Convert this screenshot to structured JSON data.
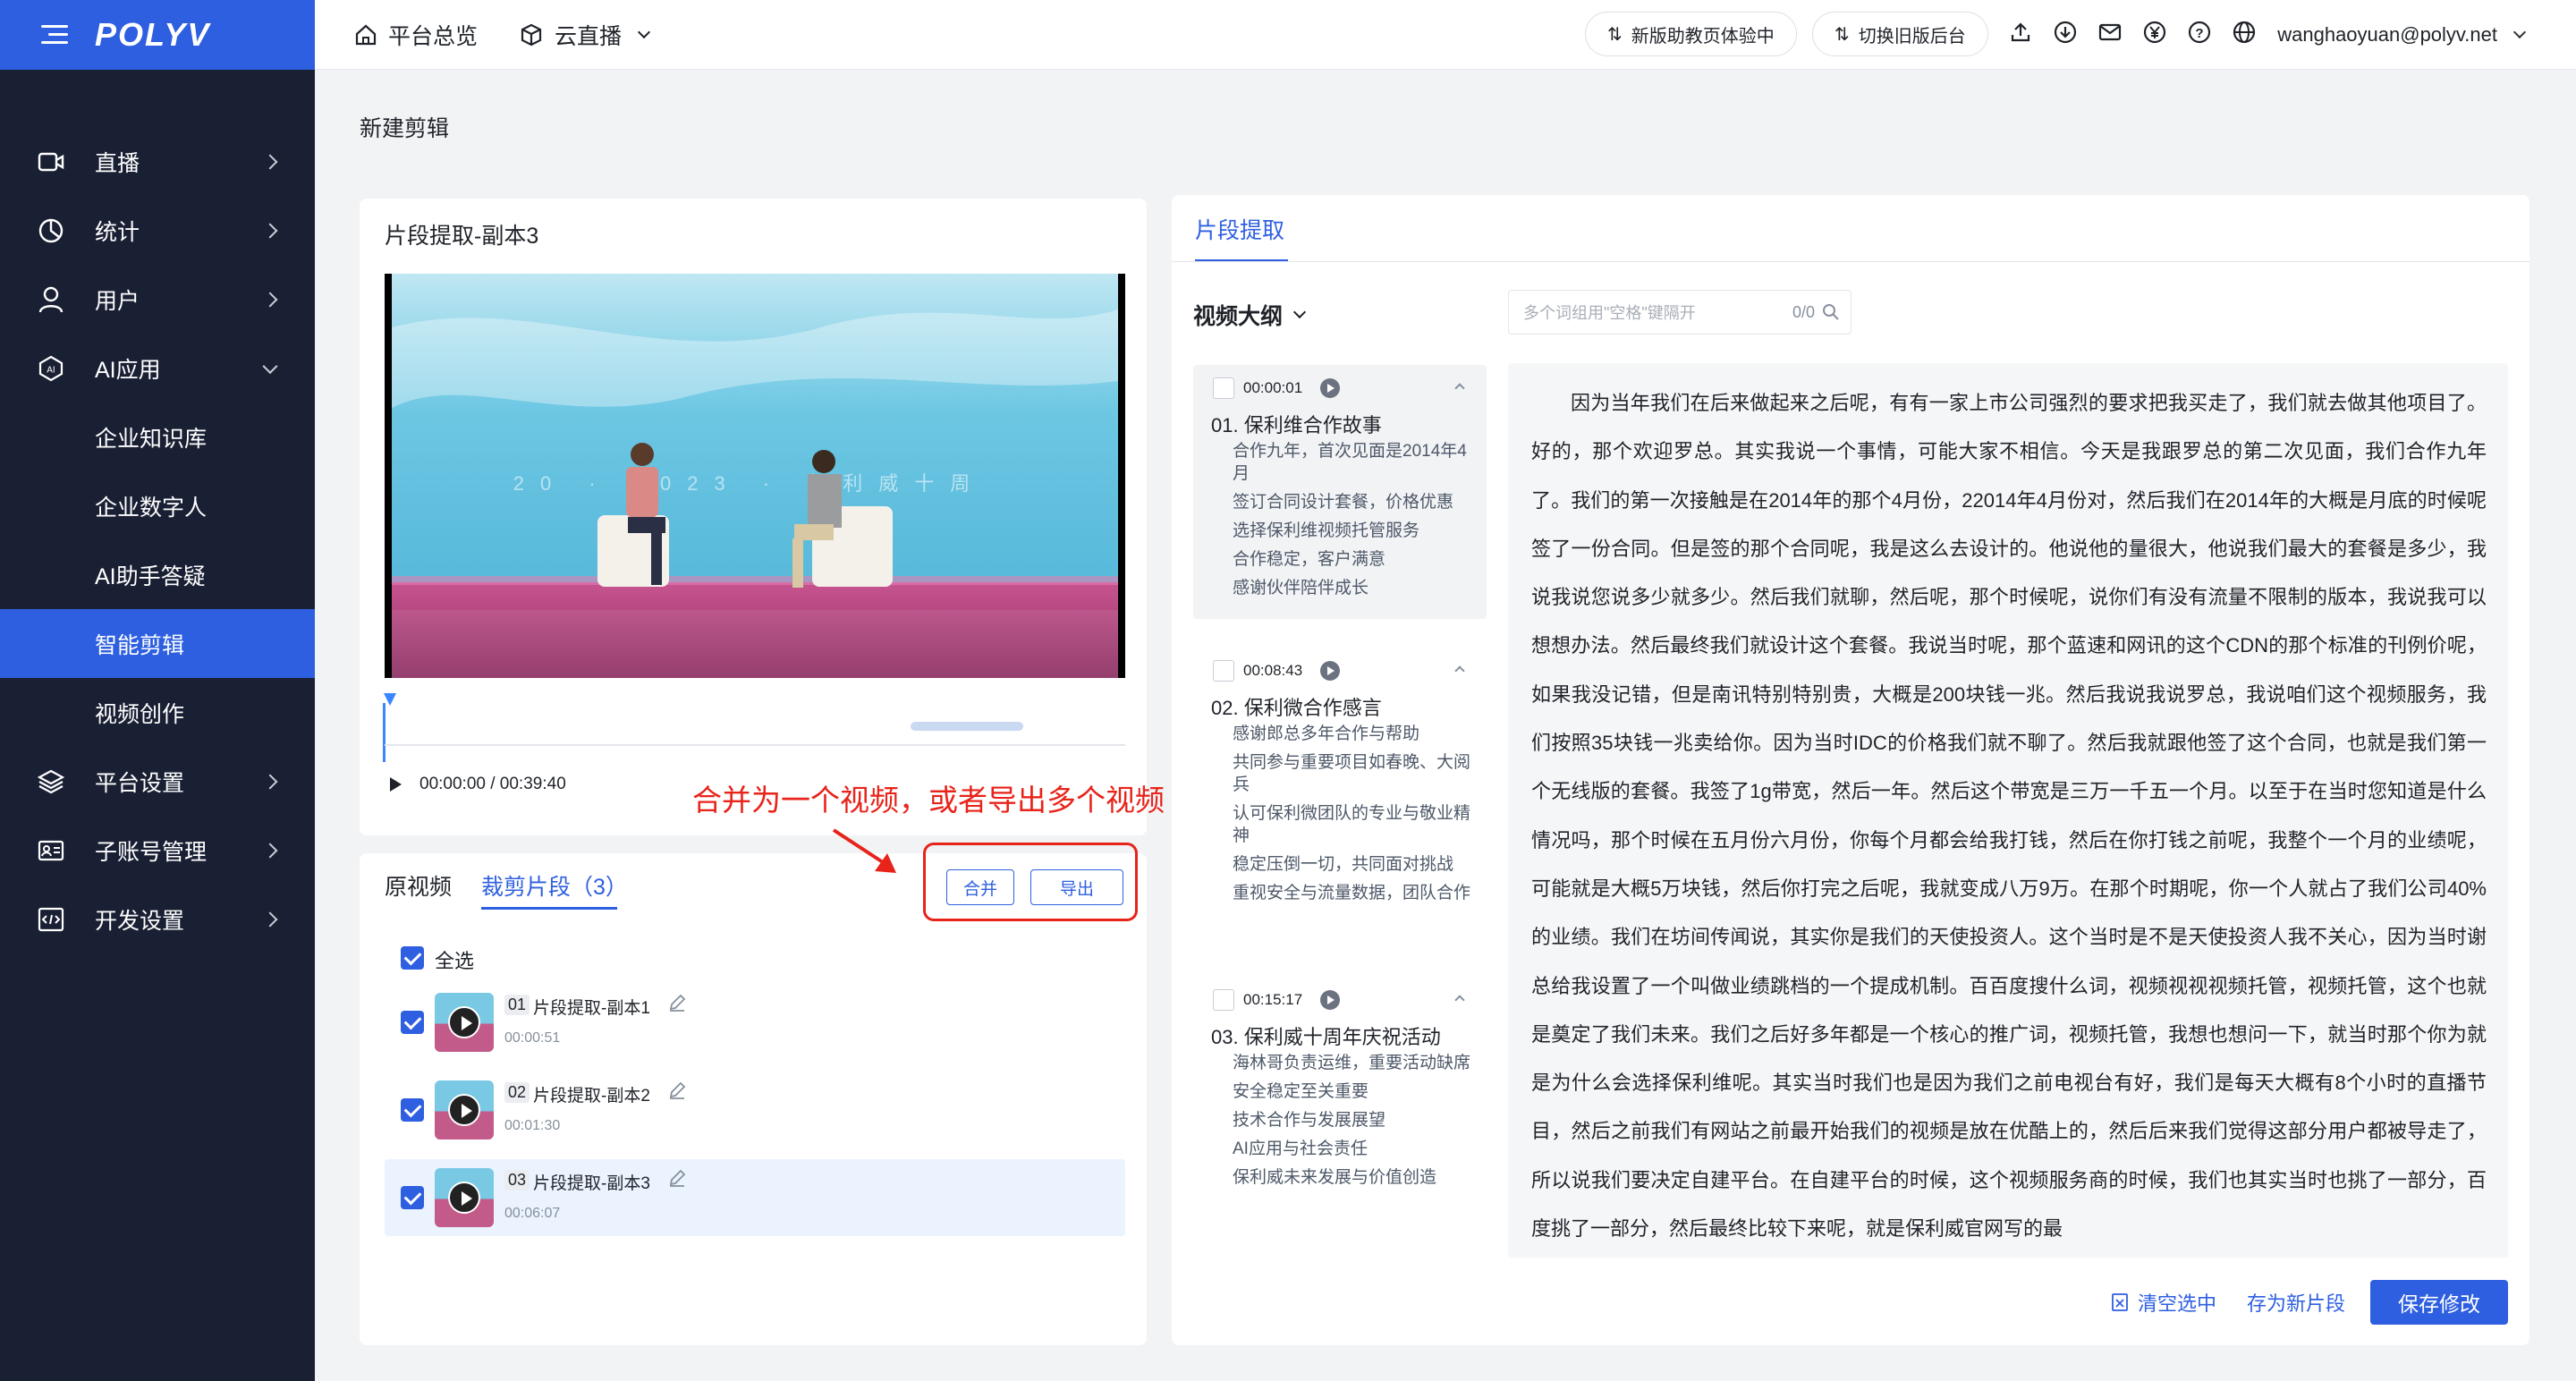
{
  "brand": {
    "logo": "POLYV",
    "accent": "#2e5fe0"
  },
  "sidebar": {
    "items": [
      {
        "label": "直播",
        "icon": "live-icon",
        "chevron": "right"
      },
      {
        "label": "统计",
        "icon": "stats-icon",
        "chevron": "right"
      },
      {
        "label": "用户",
        "icon": "user-icon",
        "chevron": "right"
      },
      {
        "label": "AI应用",
        "icon": "ai-icon",
        "chevron": "down"
      },
      {
        "label": "企业知识库"
      },
      {
        "label": "企业数字人"
      },
      {
        "label": "AI助手答疑"
      },
      {
        "label": "智能剪辑",
        "active": true
      },
      {
        "label": "视频创作"
      },
      {
        "label": "平台设置",
        "icon": "layers-icon",
        "chevron": "right"
      },
      {
        "label": "子账号管理",
        "icon": "id-card-icon",
        "chevron": "right"
      },
      {
        "label": "开发设置",
        "icon": "code-icon",
        "chevron": "right"
      }
    ]
  },
  "header": {
    "nav_home": "平台总览",
    "nav_live": "云直播",
    "btn_new_teaching": "新版助教页体验中",
    "btn_switch_old": "切换旧版后台",
    "user_email": "wanghaoyuan@polyv.net"
  },
  "page": {
    "title": "新建剪辑"
  },
  "player": {
    "title": "片段提取-副本3",
    "time": "00:00:00 / 00:39:40",
    "banner_text": "20 · 2023 · 保利威十周"
  },
  "annotation": {
    "text": "合并为一个视频，或者导出多个视频"
  },
  "clip_panel": {
    "tab_original": "原视频",
    "tab_clips": "裁剪片段（3）",
    "merge_button": "合并",
    "export_button": "导出",
    "select_all": "全选",
    "clips": [
      {
        "num": "01",
        "name": "片段提取-副本1",
        "duration": "00:00:51"
      },
      {
        "num": "02",
        "name": "片段提取-副本2",
        "duration": "00:01:30"
      },
      {
        "num": "03",
        "name": "片段提取-副本3",
        "duration": "00:06:07"
      }
    ]
  },
  "right_panel": {
    "tab": "片段提取",
    "outline_label": "视频大纲",
    "search_placeholder": "多个词组用\"空格\"键隔开",
    "search_count": "0/0",
    "outline": [
      {
        "time": "00:00:01",
        "title": "01. 保利维合作故事",
        "points": [
          "合作九年，首次见面是2014年4月",
          "签订合同设计套餐，价格优惠",
          "选择保利维视频托管服务",
          "合作稳定，客户满意",
          "感谢伙伴陪伴成长"
        ]
      },
      {
        "time": "00:08:43",
        "title": "02. 保利微合作感言",
        "points": [
          "感谢郎总多年合作与帮助",
          "共同参与重要项目如春晚、大阅兵",
          "认可保利微团队的专业与敬业精神",
          "稳定压倒一切，共同面对挑战",
          "重视安全与流量数据，团队合作"
        ]
      },
      {
        "time": "00:15:17",
        "title": "03. 保利威十周年庆祝活动",
        "points": [
          "海林哥负责运维，重要活动缺席",
          "安全稳定至关重要",
          "技术合作与发展展望",
          "AI应用与社会责任",
          "保利威未来发展与价值创造"
        ]
      }
    ],
    "transcript": "因为当年我们在后来做起来之后呢，有有一家上市公司强烈的要求把我买走了，我们就去做其他项目了。好的，那个欢迎罗总。其实我说一个事情，可能大家不相信。今天是我跟罗总的第二次见面，我们合作九年了。我们的第一次接触是在2014年的那个4月份，22014年4月份对，然后我们在2014年的大概是月底的时候呢签了一份合同。但是签的那个合同呢，我是这么去设计的。他说他的量很大，他说我们最大的套餐是多少，我说我说您说多少就多少。然后我们就聊，然后呢，那个时候呢，说你们有没有流量不限制的版本，我说我可以想想办法。然后最终我们就设计这个套餐。我说当时呢，那个蓝速和网讯的这个CDN的那个标准的刊例价呢，如果我没记错，但是南讯特别特别贵，大概是200块钱一兆。然后我说我说罗总，我说咱们这个视频服务，我们按照35块钱一兆卖给你。因为当时IDC的价格我们就不聊了。然后我就跟他签了这个合同，也就是我们第一个无线版的套餐。我签了1g带宽，然后一年。然后这个带宽是三万一千五一个月。以至于在当时您知道是什么情况吗，那个时候在五月份六月份，你每个月都会给我打钱，然后在你打钱之前呢，我整个一个月的业绩呢，可能就是大概5万块钱，然后你打完之后呢，我就变成八万9万。在那个时期呢，你一个人就占了我们公司40%的业绩。我们在坊间传闻说，其实你是我们的天使投资人。这个当时是不是天使投资人我不关心，因为当时谢总给我设置了一个叫做业绩跳档的一个提成机制。百百度搜什么词，视频视视视频托管，视频托管，这个也就是奠定了我们未来。我们之后好多年都是一个核心的推广词，视频托管，我想也想问一下，就当时那个你为就是为什么会选择保利维呢。其实当时我们也是因为我们之前电视台有好，我们是每天大概有8个小时的直播节目，然后之前我们有网站之前最开始我们的视频是放在优酷上的，然后后来我们觉得这部分用户都被导走了，所以说我们要决定自建平台。在自建平台的时候，这个视频服务商的时候，我们也其实当时也挑了一部分，百度挑了一部分，然后最终比较下来呢，就是保利威官网写的最",
    "clear_selection": "清空选中",
    "save_as_new": "存为新片段",
    "save_changes": "保存修改"
  }
}
